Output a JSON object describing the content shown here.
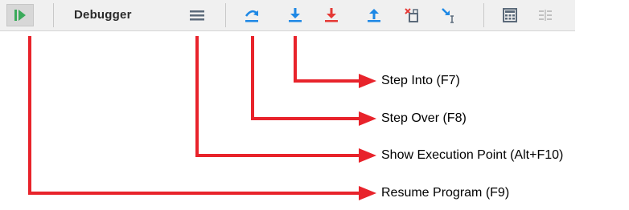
{
  "toolbar": {
    "tab_label": "Debugger",
    "buttons": [
      {
        "icon": "resume-icon",
        "color": "#3aaa5a"
      },
      {
        "icon": "show-execution-point-icon",
        "color": "#5b6a7a"
      },
      {
        "icon": "step-over-icon",
        "color": "#1e88e5"
      },
      {
        "icon": "step-into-icon",
        "color": "#1e88e5"
      },
      {
        "icon": "force-step-into-icon",
        "color": "#e53935"
      },
      {
        "icon": "step-out-icon",
        "color": "#1e88e5"
      },
      {
        "icon": "drop-frame-icon",
        "color": "#e53935"
      },
      {
        "icon": "run-to-cursor-icon",
        "color": "#1e88e5"
      },
      {
        "icon": "evaluate-expression-icon",
        "color": "#5b6a7a"
      },
      {
        "icon": "trace-icon",
        "color": "#b0b0b0"
      }
    ]
  },
  "callouts": {
    "step_into": "Step Into (F7)",
    "step_over": "Step Over (F8)",
    "show_execution_point": "Show Execution Point (Alt+F10)",
    "resume_program": "Resume Program (F9)"
  },
  "colors": {
    "arrow": "#e8232b",
    "toolbar_bg": "#f0f0f0"
  }
}
